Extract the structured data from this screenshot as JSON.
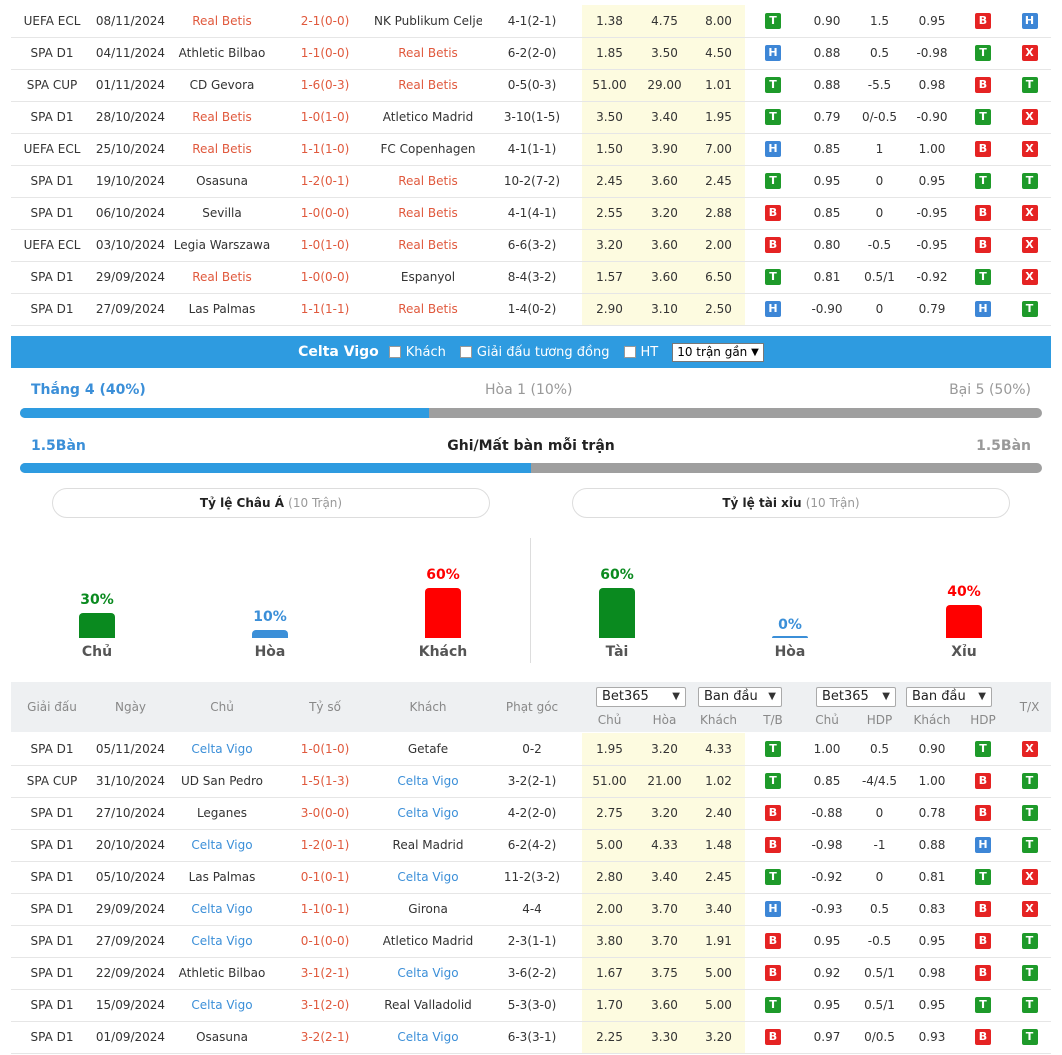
{
  "top_matches": [
    {
      "league": "UEFA ECL",
      "date": "08/11/2024",
      "home": "Real Betis",
      "home_hl": true,
      "score": "2-1(0-0)",
      "away": "NK Publikum Celje",
      "away_hl": false,
      "corner": "4-1(2-1)",
      "o1": "1.38",
      "o2": "4.75",
      "o3": "8.00",
      "r1": "T",
      "h1": "0.90",
      "h2": "1.5",
      "h3": "0.95",
      "r2": "B",
      "r3": "H"
    },
    {
      "league": "SPA D1",
      "date": "04/11/2024",
      "home": "Athletic Bilbao",
      "home_hl": false,
      "score": "1-1(0-0)",
      "away": "Real Betis",
      "away_hl": true,
      "corner": "6-2(2-0)",
      "o1": "1.85",
      "o2": "3.50",
      "o3": "4.50",
      "r1": "H",
      "h1": "0.88",
      "h2": "0.5",
      "h3": "-0.98",
      "r2": "T",
      "r3": "X"
    },
    {
      "league": "SPA CUP",
      "date": "01/11/2024",
      "home": "CD Gevora",
      "home_hl": false,
      "score": "1-6(0-3)",
      "away": "Real Betis",
      "away_hl": true,
      "corner": "0-5(0-3)",
      "o1": "51.00",
      "o2": "29.00",
      "o3": "1.01",
      "r1": "T",
      "h1": "0.88",
      "h2": "-5.5",
      "h3": "0.98",
      "r2": "B",
      "r3": "T"
    },
    {
      "league": "SPA D1",
      "date": "28/10/2024",
      "home": "Real Betis",
      "home_hl": true,
      "score": "1-0(1-0)",
      "away": "Atletico Madrid",
      "away_hl": false,
      "corner": "3-10(1-5)",
      "o1": "3.50",
      "o2": "3.40",
      "o3": "1.95",
      "r1": "T",
      "h1": "0.79",
      "h2": "0/-0.5",
      "h3": "-0.90",
      "r2": "T",
      "r3": "X"
    },
    {
      "league": "UEFA ECL",
      "date": "25/10/2024",
      "home": "Real Betis",
      "home_hl": true,
      "score": "1-1(1-0)",
      "away": "FC Copenhagen",
      "away_hl": false,
      "corner": "4-1(1-1)",
      "o1": "1.50",
      "o2": "3.90",
      "o3": "7.00",
      "r1": "H",
      "h1": "0.85",
      "h2": "1",
      "h3": "1.00",
      "r2": "B",
      "r3": "X"
    },
    {
      "league": "SPA D1",
      "date": "19/10/2024",
      "home": "Osasuna",
      "home_hl": false,
      "score": "1-2(0-1)",
      "away": "Real Betis",
      "away_hl": true,
      "corner": "10-2(7-2)",
      "o1": "2.45",
      "o2": "3.60",
      "o3": "2.45",
      "r1": "T",
      "h1": "0.95",
      "h2": "0",
      "h3": "0.95",
      "r2": "T",
      "r3": "T"
    },
    {
      "league": "SPA D1",
      "date": "06/10/2024",
      "home": "Sevilla",
      "home_hl": false,
      "score": "1-0(0-0)",
      "away": "Real Betis",
      "away_hl": true,
      "corner": "4-1(4-1)",
      "o1": "2.55",
      "o2": "3.20",
      "o3": "2.88",
      "r1": "B",
      "h1": "0.85",
      "h2": "0",
      "h3": "-0.95",
      "r2": "B",
      "r3": "X"
    },
    {
      "league": "UEFA ECL",
      "date": "03/10/2024",
      "home": "Legia Warszawa",
      "home_hl": false,
      "score": "1-0(1-0)",
      "away": "Real Betis",
      "away_hl": true,
      "corner": "6-6(3-2)",
      "o1": "3.20",
      "o2": "3.60",
      "o3": "2.00",
      "r1": "B",
      "h1": "0.80",
      "h2": "-0.5",
      "h3": "-0.95",
      "r2": "B",
      "r3": "X"
    },
    {
      "league": "SPA D1",
      "date": "29/09/2024",
      "home": "Real Betis",
      "home_hl": true,
      "score": "1-0(0-0)",
      "away": "Espanyol",
      "away_hl": false,
      "corner": "8-4(3-2)",
      "o1": "1.57",
      "o2": "3.60",
      "o3": "6.50",
      "r1": "T",
      "h1": "0.81",
      "h2": "0.5/1",
      "h3": "-0.92",
      "r2": "T",
      "r3": "X"
    },
    {
      "league": "SPA D1",
      "date": "27/09/2024",
      "home": "Las Palmas",
      "home_hl": false,
      "score": "1-1(1-1)",
      "away": "Real Betis",
      "away_hl": true,
      "corner": "1-4(0-2)",
      "o1": "2.90",
      "o2": "3.10",
      "o3": "2.50",
      "r1": "H",
      "h1": "-0.90",
      "h2": "0",
      "h3": "0.79",
      "r2": "H",
      "r3": "T"
    }
  ],
  "filter_bar": {
    "team": "Celta Vigo",
    "opt_away": "Khách",
    "opt_same_league": "Giải đấu tương đồng",
    "opt_ht": "HT",
    "select_value": "10 trận gần"
  },
  "summary": {
    "win_label": "Thắng 4 (40%)",
    "draw_label": "Hòa 1 (10%)",
    "loss_label": "Bại 5 (50%)",
    "win_pct": 40,
    "goals_for": "1.5Bàn",
    "goals_title": "Ghi/Mất bàn mỗi trận",
    "goals_against": "1.5Bàn",
    "goals_pct": 50
  },
  "asian_pill": {
    "title": "Tỷ lệ Châu Á",
    "sub": "(10 Trận)"
  },
  "ou_pill": {
    "title": "Tỷ lệ tài xỉu",
    "sub": "(10 Trận)"
  },
  "asian_stats": [
    {
      "label": "Chủ",
      "pct_label": "30%",
      "pct": 30,
      "color": "#0a8a1f"
    },
    {
      "label": "Hòa",
      "pct_label": "10%",
      "pct": 10,
      "color": "#3b8fd8"
    },
    {
      "label": "Khách",
      "pct_label": "60%",
      "pct": 60,
      "color": "#ff0000"
    }
  ],
  "ou_stats": [
    {
      "label": "Tài",
      "pct_label": "60%",
      "pct": 60,
      "color": "#0a8a1f"
    },
    {
      "label": "Hòa",
      "pct_label": "0%",
      "pct": 0,
      "color": "#3b8fd8"
    },
    {
      "label": "Xỉu",
      "pct_label": "40%",
      "pct": 40,
      "color": "#ff0000"
    }
  ],
  "table_header": {
    "league": "Giải đấu",
    "date": "Ngày",
    "home": "Chủ",
    "score": "Tỷ số",
    "away": "Khách",
    "corner": "Phạt góc",
    "book1": "Bet365",
    "type1": "Ban đầu",
    "book2": "Bet365",
    "type2": "Ban đầu",
    "c_home": "Chủ",
    "c_draw": "Hòa",
    "c_away": "Khách",
    "c_tb": "T/B",
    "c_home2": "Chủ",
    "c_hdp": "HDP",
    "c_away2": "Khách",
    "c_hdp2": "HDP",
    "tx": "T/X"
  },
  "bottom_matches": [
    {
      "league": "SPA D1",
      "date": "05/11/2024",
      "home": "Celta Vigo",
      "home_hl": true,
      "score": "1-0(1-0)",
      "away": "Getafe",
      "away_hl": false,
      "corner": "0-2",
      "o1": "1.95",
      "o2": "3.20",
      "o3": "4.33",
      "r1": "T",
      "h1": "1.00",
      "h2": "0.5",
      "h3": "0.90",
      "r2": "T",
      "r3": "X"
    },
    {
      "league": "SPA CUP",
      "date": "31/10/2024",
      "home": "UD San Pedro",
      "home_hl": false,
      "score": "1-5(1-3)",
      "away": "Celta Vigo",
      "away_hl": true,
      "corner": "3-2(2-1)",
      "o1": "51.00",
      "o2": "21.00",
      "o3": "1.02",
      "r1": "T",
      "h1": "0.85",
      "h2": "-4/4.5",
      "h3": "1.00",
      "r2": "B",
      "r3": "T"
    },
    {
      "league": "SPA D1",
      "date": "27/10/2024",
      "home": "Leganes",
      "home_hl": false,
      "score": "3-0(0-0)",
      "away": "Celta Vigo",
      "away_hl": true,
      "corner": "4-2(2-0)",
      "o1": "2.75",
      "o2": "3.20",
      "o3": "2.40",
      "r1": "B",
      "h1": "-0.88",
      "h2": "0",
      "h3": "0.78",
      "r2": "B",
      "r3": "T"
    },
    {
      "league": "SPA D1",
      "date": "20/10/2024",
      "home": "Celta Vigo",
      "home_hl": true,
      "score": "1-2(0-1)",
      "away": "Real Madrid",
      "away_hl": false,
      "corner": "6-2(4-2)",
      "o1": "5.00",
      "o2": "4.33",
      "o3": "1.48",
      "r1": "B",
      "h1": "-0.98",
      "h2": "-1",
      "h3": "0.88",
      "r2": "H",
      "r3": "T"
    },
    {
      "league": "SPA D1",
      "date": "05/10/2024",
      "home": "Las Palmas",
      "home_hl": false,
      "score": "0-1(0-1)",
      "away": "Celta Vigo",
      "away_hl": true,
      "corner": "11-2(3-2)",
      "o1": "2.80",
      "o2": "3.40",
      "o3": "2.45",
      "r1": "T",
      "h1": "-0.92",
      "h2": "0",
      "h3": "0.81",
      "r2": "T",
      "r3": "X"
    },
    {
      "league": "SPA D1",
      "date": "29/09/2024",
      "home": "Celta Vigo",
      "home_hl": true,
      "score": "1-1(0-1)",
      "away": "Girona",
      "away_hl": false,
      "corner": "4-4",
      "o1": "2.00",
      "o2": "3.70",
      "o3": "3.40",
      "r1": "H",
      "h1": "-0.93",
      "h2": "0.5",
      "h3": "0.83",
      "r2": "B",
      "r3": "X"
    },
    {
      "league": "SPA D1",
      "date": "27/09/2024",
      "home": "Celta Vigo",
      "home_hl": true,
      "score": "0-1(0-0)",
      "away": "Atletico Madrid",
      "away_hl": false,
      "corner": "2-3(1-1)",
      "o1": "3.80",
      "o2": "3.70",
      "o3": "1.91",
      "r1": "B",
      "h1": "0.95",
      "h2": "-0.5",
      "h3": "0.95",
      "r2": "B",
      "r3": "T"
    },
    {
      "league": "SPA D1",
      "date": "22/09/2024",
      "home": "Athletic Bilbao",
      "home_hl": false,
      "score": "3-1(2-1)",
      "away": "Celta Vigo",
      "away_hl": true,
      "corner": "3-6(2-2)",
      "o1": "1.67",
      "o2": "3.75",
      "o3": "5.00",
      "r1": "B",
      "h1": "0.92",
      "h2": "0.5/1",
      "h3": "0.98",
      "r2": "B",
      "r3": "T"
    },
    {
      "league": "SPA D1",
      "date": "15/09/2024",
      "home": "Celta Vigo",
      "home_hl": true,
      "score": "3-1(2-0)",
      "away": "Real Valladolid",
      "away_hl": false,
      "corner": "5-3(3-0)",
      "o1": "1.70",
      "o2": "3.60",
      "o3": "5.00",
      "r1": "T",
      "h1": "0.95",
      "h2": "0.5/1",
      "h3": "0.95",
      "r2": "T",
      "r3": "T"
    },
    {
      "league": "SPA D1",
      "date": "01/09/2024",
      "home": "Osasuna",
      "home_hl": false,
      "score": "3-2(2-1)",
      "away": "Celta Vigo",
      "away_hl": true,
      "corner": "6-3(3-1)",
      "o1": "2.25",
      "o2": "3.30",
      "o3": "3.20",
      "r1": "B",
      "h1": "0.97",
      "h2": "0/0.5",
      "h3": "0.93",
      "r2": "B",
      "r3": "T"
    }
  ]
}
